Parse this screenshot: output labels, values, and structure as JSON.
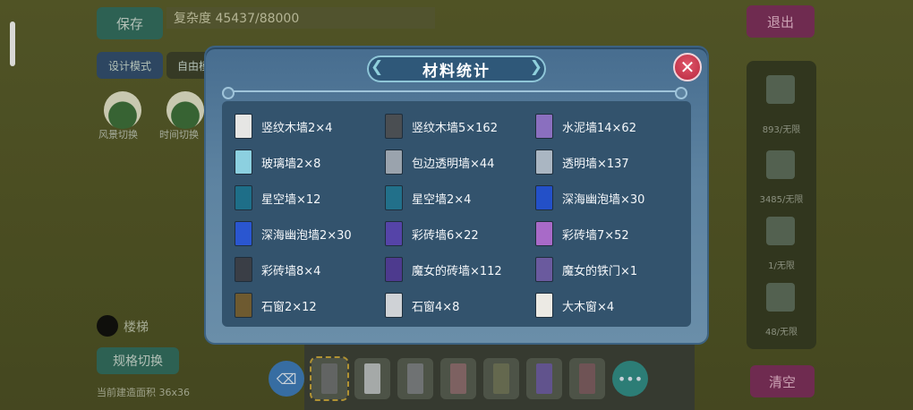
{
  "background": {
    "save_label": "保存",
    "complexity_text": "复杂度 45437/88000",
    "exit_label": "退出",
    "design_mode_label": "设计模式",
    "mode_value": "自由模",
    "circle_labels": [
      "风景切换",
      "时间切换"
    ],
    "right_panel_counts": [
      "893/无限",
      "3485/无限",
      "1/无限",
      "48/无限"
    ],
    "toggle_label": "楼梯",
    "switch_label": "规格切换",
    "bottom_note": "当前建造面积 36x36",
    "clear_label": "清空"
  },
  "modal": {
    "title": "材料统计",
    "close_label": "✕",
    "items": [
      {
        "label": "竖纹木墙2×4",
        "color": "#e6e6e4",
        "icon": "vertical-wood-wall-icon"
      },
      {
        "label": "竖纹木墙5×162",
        "color": "#4a4e52",
        "icon": "vertical-wood-wall-dark-icon"
      },
      {
        "label": "水泥墙14×62",
        "color": "#8a6fbf",
        "icon": "cement-wall-icon"
      },
      {
        "label": "玻璃墙2×8",
        "color": "#8cd0e0",
        "icon": "glass-wall-icon"
      },
      {
        "label": "包边透明墙×44",
        "color": "#9aa3ad",
        "icon": "edged-transparent-wall-icon"
      },
      {
        "label": "透明墙×137",
        "color": "#aab6c2",
        "icon": "transparent-wall-icon"
      },
      {
        "label": "星空墙×12",
        "color": "#1e6e88",
        "icon": "starry-wall-icon"
      },
      {
        "label": "星空墙2×4",
        "color": "#22708a",
        "icon": "starry-wall-2-icon"
      },
      {
        "label": "深海幽泡墙×30",
        "color": "#2350c8",
        "icon": "deep-sea-bubble-wall-icon"
      },
      {
        "label": "深海幽泡墙2×30",
        "color": "#2a56d0",
        "icon": "deep-sea-bubble-wall-2-icon"
      },
      {
        "label": "彩砖墙6×22",
        "color": "#5544a8",
        "icon": "colored-brick-wall-6-icon"
      },
      {
        "label": "彩砖墙7×52",
        "color": "#a86ac8",
        "icon": "colored-brick-wall-7-icon"
      },
      {
        "label": "彩砖墙8×4",
        "color": "#3a3e46",
        "icon": "colored-brick-wall-8-icon"
      },
      {
        "label": "魔女的砖墙×112",
        "color": "#4d3a8e",
        "icon": "witch-brick-wall-icon"
      },
      {
        "label": "魔女的铁门×1",
        "color": "#6a5a9e",
        "icon": "witch-iron-door-icon"
      },
      {
        "label": "石窗2×12",
        "color": "#6e5a30",
        "icon": "stone-window-2-icon"
      },
      {
        "label": "石窗4×8",
        "color": "#cfd2d6",
        "icon": "stone-window-4-icon"
      },
      {
        "label": "大木窗×4",
        "color": "#eceae4",
        "icon": "large-wood-window-icon"
      }
    ]
  }
}
